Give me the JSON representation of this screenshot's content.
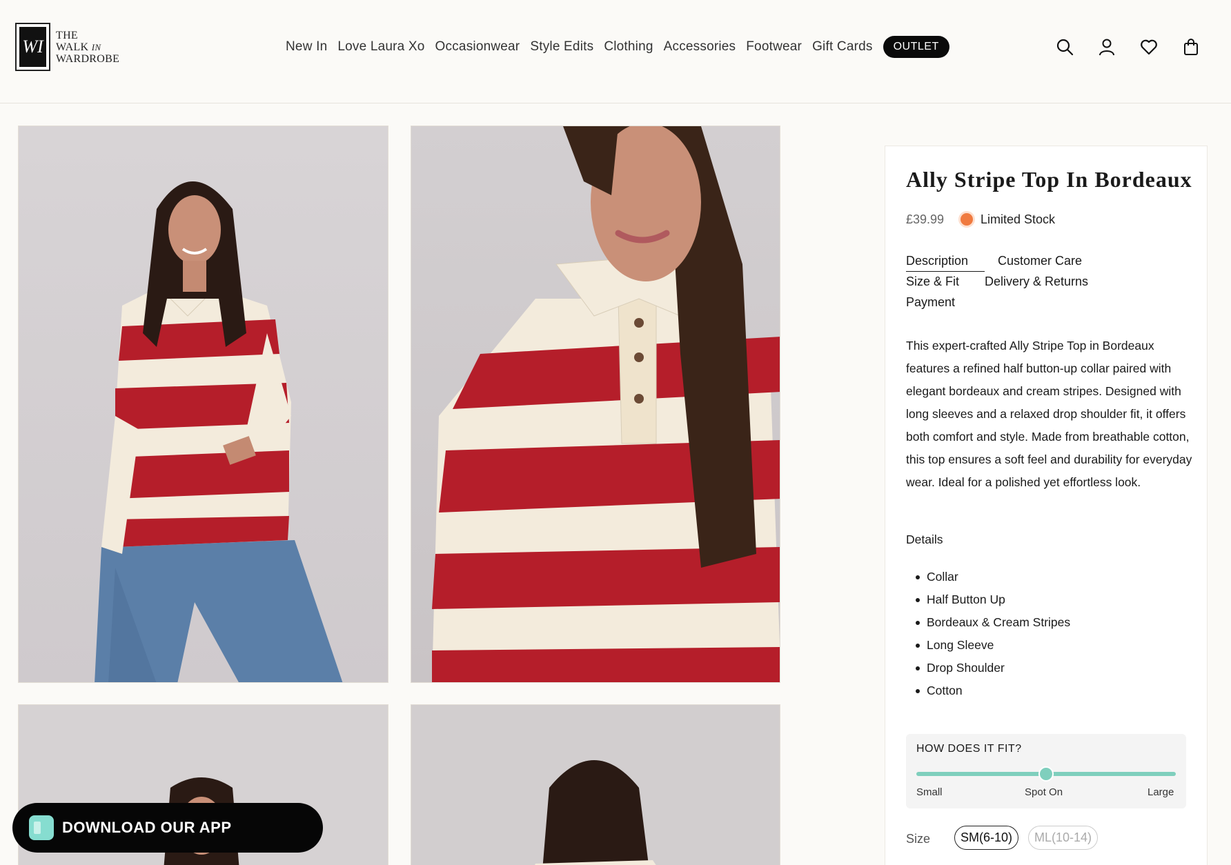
{
  "brand": {
    "line1": "THE",
    "line2": "WALK",
    "line2b": "IN",
    "line3": "WARDROBE",
    "mark": "WI"
  },
  "nav": {
    "items": [
      "New In",
      "Love Laura Xo",
      "Occasionwear",
      "Style Edits",
      "Clothing",
      "Accessories",
      "Footwear",
      "Gift Cards"
    ],
    "outlet": "OUTLET"
  },
  "header_icons": [
    "search-icon",
    "account-icon",
    "heart-icon",
    "bag-icon"
  ],
  "product": {
    "title": "Ally Stripe Top In Bordeaux",
    "price": "£39.99",
    "stock": "Limited Stock",
    "stock_color": "#f07a3f",
    "tabs": [
      "Description",
      "Customer Care",
      "Size & Fit",
      "Delivery & Returns",
      "Payment"
    ],
    "description": "This expert-crafted Ally Stripe Top in Bordeaux features a refined half button-up collar paired with elegant bordeaux and cream stripes. Designed with long sleeves and a relaxed drop shoulder fit, it offers both comfort and style. Made from breathable cotton, this top ensures a soft feel and durability for everyday wear. Ideal for a polished yet effortless look.",
    "details_heading": "Details",
    "details": [
      "Collar",
      "Half Button Up",
      "Bordeaux & Cream Stripes",
      "Long Sleeve",
      "Drop Shoulder",
      "Cotton"
    ]
  },
  "fit": {
    "title": "HOW DOES IT FIT?",
    "labels": [
      "Small",
      "Spot On",
      "Large"
    ],
    "value": 0.5,
    "accent": "#7fcfbd"
  },
  "size": {
    "label": "Size",
    "options": [
      "SM(6-10)",
      "ML(10-14)"
    ],
    "selected": "SM(6-10)"
  },
  "app_banner": {
    "label": "DOWNLOAD OUR APP"
  }
}
